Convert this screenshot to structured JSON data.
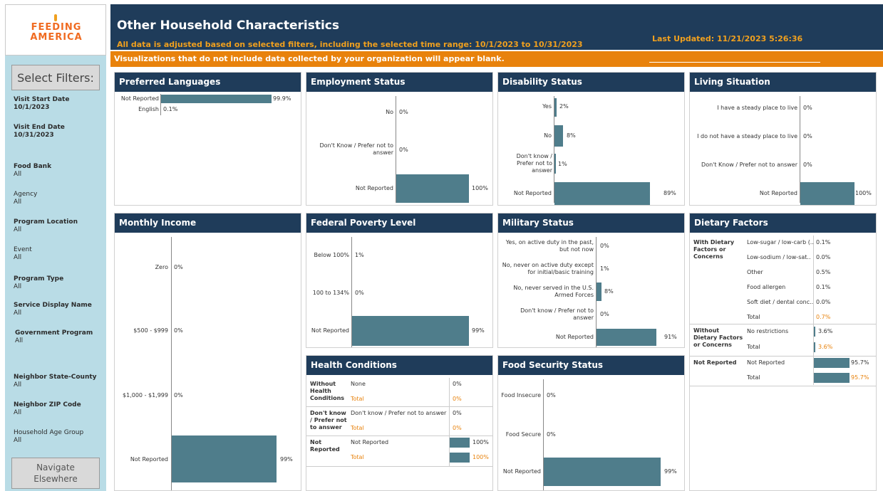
{
  "logo": {
    "line1": "FEEDING",
    "line2": "AMERICA"
  },
  "sidebar": {
    "select_filters": "Select Filters:",
    "filters": [
      {
        "label": "Visit Start Date",
        "value": "10/1/2023"
      },
      {
        "label": "Visit End Date",
        "value": "10/31/2023"
      },
      {
        "label": "Food Bank",
        "value": "All"
      },
      {
        "label": "Agency",
        "value": "All"
      },
      {
        "label": "Program Location",
        "value": "All"
      },
      {
        "label": "Event",
        "value": "All"
      },
      {
        "label": "Program Type",
        "value": "All"
      },
      {
        "label": "Service Display Name",
        "value": "All"
      },
      {
        "label": "Government Program",
        "value": "All"
      },
      {
        "label": "Neighbor State-County",
        "value": "All"
      },
      {
        "label": "Neighbor ZIP Code",
        "value": "All"
      },
      {
        "label": "Household Age Group",
        "value": "All"
      }
    ],
    "navigate_line1": "Navigate",
    "navigate_line2": "Elsewhere"
  },
  "header": {
    "title": "Other Household Characteristics",
    "subtitle": "All data is adjusted based on selected filters, including the selected time range:  10/1/2023 to 10/31/2023",
    "last_updated": "Last Updated: 11/21/2023 5:26:36",
    "banner": "Visualizations that do not include data collected by your organization will appear blank."
  },
  "colors": {
    "navy": "#1f3c5a",
    "orange": "#e8820c",
    "bar": "#4f7d8b",
    "sidebar": "#b9dce6"
  },
  "panels": {
    "languages": {
      "title": "Preferred Languages",
      "rows": [
        {
          "label": "Not Reported",
          "value": "99.9%",
          "pct": 99.9
        },
        {
          "label": "English",
          "value": "0.1%",
          "pct": 0.1
        }
      ]
    },
    "employment": {
      "title": "Employment Status",
      "rows": [
        {
          "label": "No",
          "value": "0%",
          "pct": 0
        },
        {
          "label": "Don't Know / Prefer not to answer",
          "value": "0%",
          "pct": 0
        },
        {
          "label": "Not Reported",
          "value": "100%",
          "pct": 100
        }
      ]
    },
    "disability": {
      "title": "Disability Status",
      "rows": [
        {
          "label": "Yes",
          "value": "2%",
          "pct": 2
        },
        {
          "label": "No",
          "value": "8%",
          "pct": 8
        },
        {
          "label": "Don't know / Prefer not to answer",
          "value": "1%",
          "pct": 1
        },
        {
          "label": "Not Reported",
          "value": "89%",
          "pct": 89
        }
      ]
    },
    "living": {
      "title": "Living Situation",
      "rows": [
        {
          "label": "I have a steady place to live",
          "value": "0%",
          "pct": 0
        },
        {
          "label": "I do not have a steady place to live",
          "value": "0%",
          "pct": 0
        },
        {
          "label": "Don't Know / Prefer not to answer",
          "value": "0%",
          "pct": 0
        },
        {
          "label": "Not Reported",
          "value": "100%",
          "pct": 100
        }
      ]
    },
    "income": {
      "title": "Monthly Income",
      "rows": [
        {
          "label": "Zero",
          "value": "0%",
          "pct": 0
        },
        {
          "label": "$500 - $999",
          "value": "0%",
          "pct": 0
        },
        {
          "label": "$1,000 - $1,999",
          "value": "0%",
          "pct": 0
        },
        {
          "label": "Not Reported",
          "value": "99%",
          "pct": 99
        }
      ]
    },
    "poverty": {
      "title": "Federal Poverty Level",
      "rows": [
        {
          "label": "Below 100%",
          "value": "1%",
          "pct": 1
        },
        {
          "label": "100 to 134%",
          "value": "0%",
          "pct": 0
        },
        {
          "label": "Not Reported",
          "value": "99%",
          "pct": 99
        }
      ]
    },
    "military": {
      "title": "Military Status",
      "rows": [
        {
          "label": "Yes, on active duty in the past, but not now",
          "value": "0%",
          "pct": 0
        },
        {
          "label": "No, never on active duty except for initial/basic training",
          "value": "1%",
          "pct": 1
        },
        {
          "label": "No, never served in the U.S. Armed Forces",
          "value": "8%",
          "pct": 8
        },
        {
          "label": "Don't know / Prefer not to answer",
          "value": "0%",
          "pct": 0
        },
        {
          "label": "Not Reported",
          "value": "91%",
          "pct": 91
        }
      ]
    },
    "dietary": {
      "title": "Dietary Factors",
      "groups": [
        {
          "name": "With Dietary Factors or Concerns",
          "items": [
            {
              "label": "Low-sugar / low-carb (..",
              "value": "0.1%"
            },
            {
              "label": "Low-sodium / low-sat..",
              "value": "0.0%"
            },
            {
              "label": "Other",
              "value": "0.5%"
            },
            {
              "label": "Food allergen",
              "value": "0.1%"
            },
            {
              "label": "Soft diet / dental conc..",
              "value": "0.0%"
            },
            {
              "label": "Total",
              "value": "0.7%"
            }
          ]
        },
        {
          "name": "Without Dietary Factors or Concerns",
          "items": [
            {
              "label": "No restrictions",
              "value": "3.6%"
            },
            {
              "label": "Total",
              "value": "3.6%"
            }
          ]
        },
        {
          "name": "Not Reported",
          "items": [
            {
              "label": "Not Reported",
              "value": "95.7%"
            },
            {
              "label": "Total",
              "value": "95.7%"
            }
          ]
        }
      ]
    },
    "health": {
      "title": "Health Conditions",
      "groups": [
        {
          "name": "Without Health Conditions",
          "item": "None",
          "value": "0%",
          "total_label": "Total",
          "total": "0%"
        },
        {
          "name": "Don't know / Prefer not to answer",
          "item": "Don't know / Prefer not to answer",
          "value": "0%",
          "total_label": "Total",
          "total": "0%"
        },
        {
          "name": "Not Reported",
          "item": "Not Reported",
          "value": "100%",
          "total_label": "Total",
          "total": "100%"
        }
      ]
    },
    "food": {
      "title": "Food Security Status",
      "rows": [
        {
          "label": "Food Insecure",
          "value": "0%",
          "pct": 0
        },
        {
          "label": "Food Secure",
          "value": "0%",
          "pct": 0
        },
        {
          "label": "Not Reported",
          "value": "99%",
          "pct": 99
        }
      ]
    }
  }
}
